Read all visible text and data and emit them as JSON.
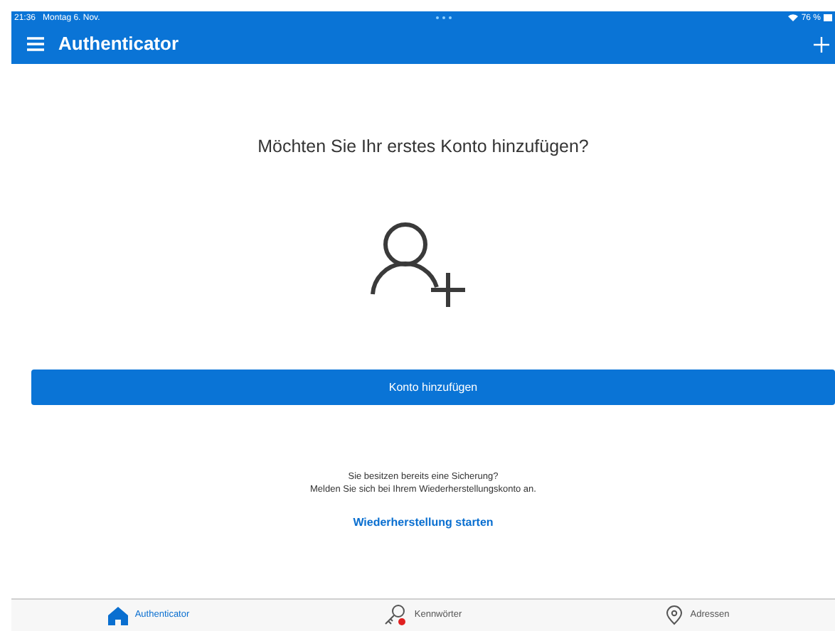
{
  "status_bar": {
    "time": "21:36",
    "date": "Montag 6. Nov.",
    "battery": "76 %"
  },
  "header": {
    "title": "Authenticator"
  },
  "prompt": "Möchten Sie Ihr erstes Konto hinzufügen?",
  "add_button": "Konto hinzufügen",
  "backup_text": [
    "Sie besitzen bereits eine Sicherung?",
    "Melden Sie sich bei Ihrem Wiederherstellungskonto an."
  ],
  "restore_link": "Wiederherstellung starten",
  "tabs": [
    {
      "kind": "home",
      "label": "Authenticator",
      "selected": true,
      "badge": false
    },
    {
      "kind": "key",
      "label": "Kennwörter",
      "selected": false,
      "badge": true
    },
    {
      "kind": "pin",
      "label": "Adressen",
      "selected": false,
      "badge": false
    }
  ]
}
